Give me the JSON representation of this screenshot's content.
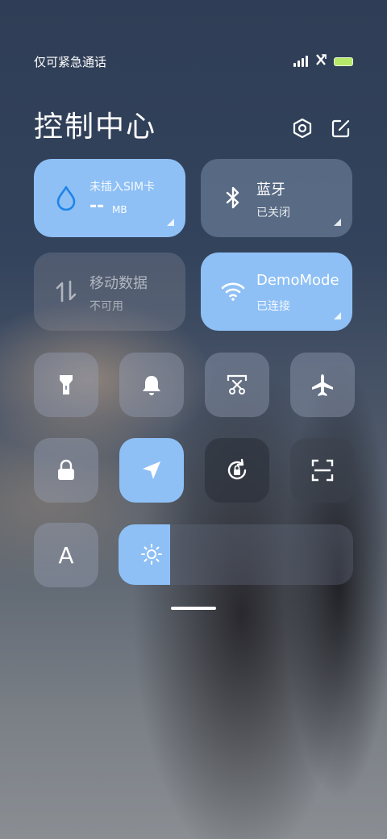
{
  "status": {
    "carrier": "仅可紧急通话",
    "battery_color": "#b6e86a"
  },
  "header": {
    "title": "控制中心"
  },
  "tiles": {
    "data": {
      "line1": "未插入SIM卡",
      "value": "--",
      "unit": "MB"
    },
    "bluetooth": {
      "label": "蓝牙",
      "state": "已关闭"
    },
    "mobile_data": {
      "label": "移动数据",
      "state": "不可用"
    },
    "wifi": {
      "label": "DemoMode",
      "state": "已连接"
    }
  },
  "toggles": [
    {
      "name": "flashlight",
      "active": false
    },
    {
      "name": "bell",
      "active": false
    },
    {
      "name": "screenshot",
      "active": false
    },
    {
      "name": "airplane",
      "active": false
    },
    {
      "name": "lock",
      "active": false
    },
    {
      "name": "location",
      "active": true
    },
    {
      "name": "rotation-lock",
      "active": false
    },
    {
      "name": "scanner",
      "active": false
    },
    {
      "name": "font-size",
      "active": false
    }
  ],
  "brightness": {
    "level": 0.22
  },
  "accent_color": "#8ec0f5",
  "font_toggle_letter": "A"
}
